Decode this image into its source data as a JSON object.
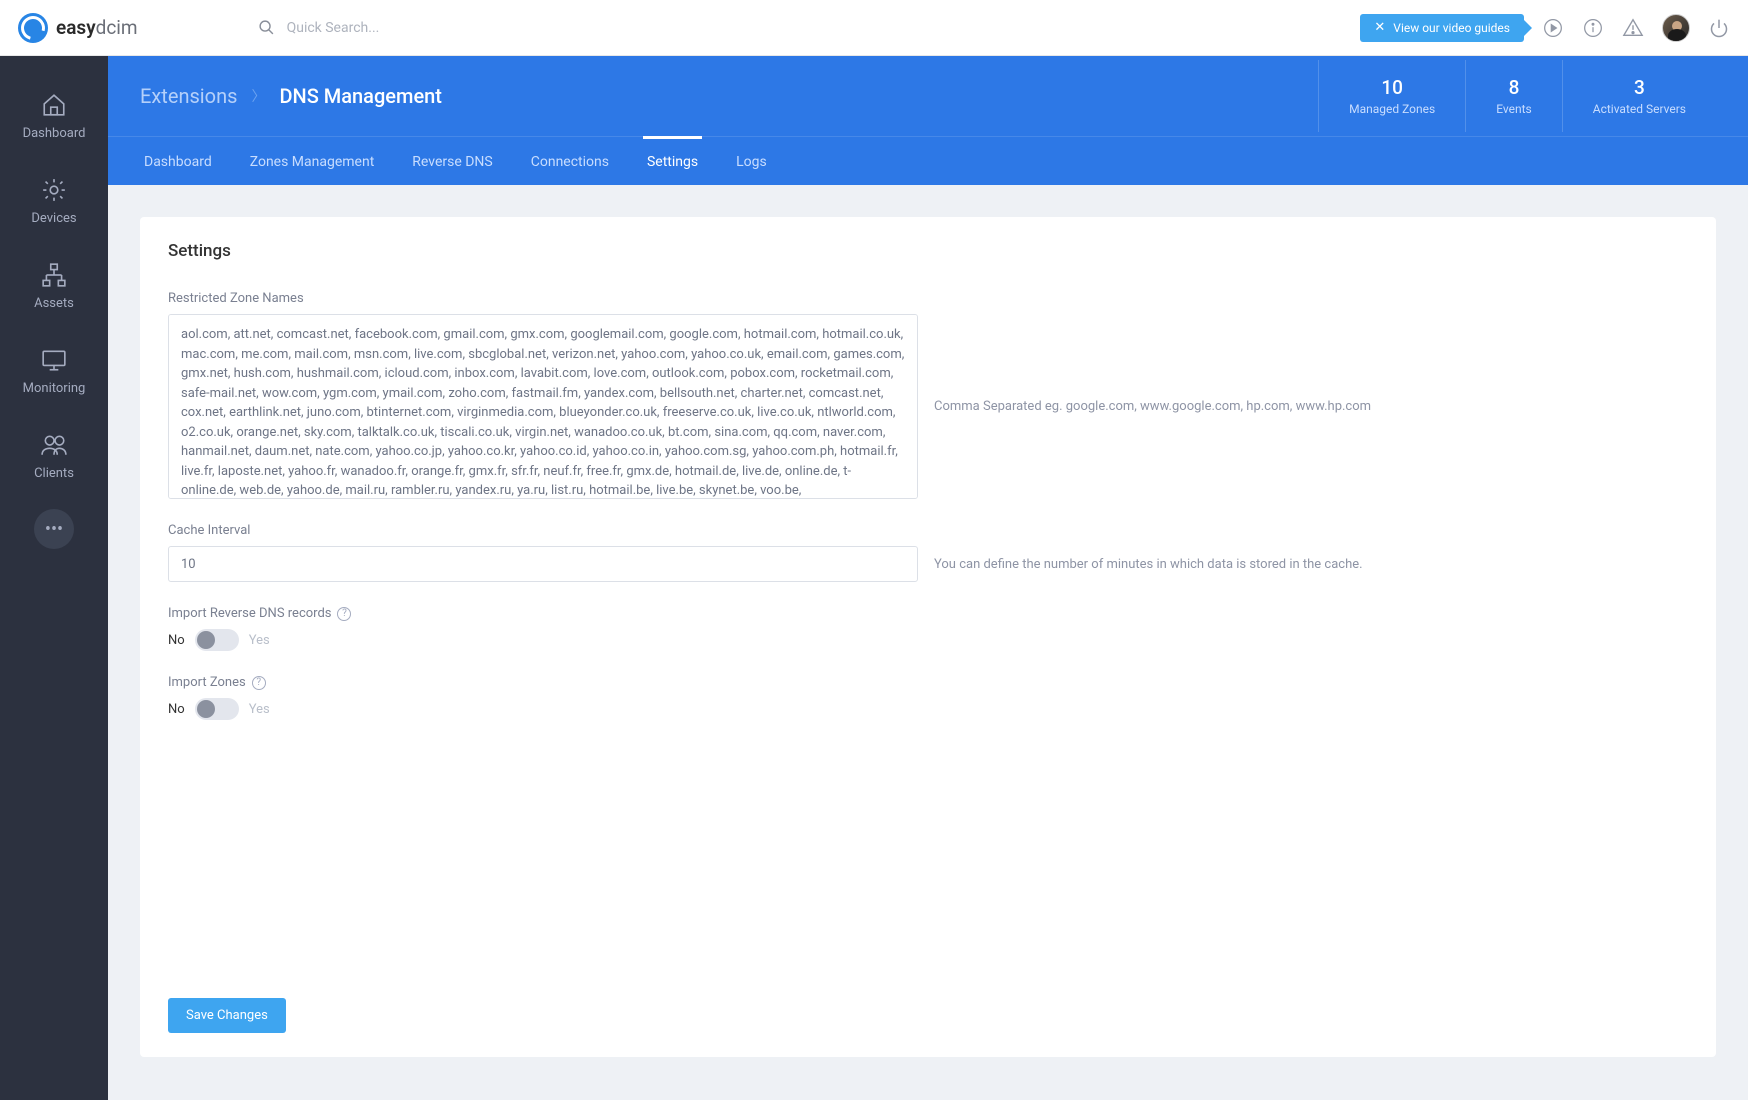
{
  "brand": {
    "name_prefix": "easy",
    "name_suffix": "dcim"
  },
  "topbar": {
    "search_placeholder": "Quick Search...",
    "video_guide_label": "View our video guides"
  },
  "sidebar": {
    "items": [
      {
        "id": "dashboard",
        "label": "Dashboard"
      },
      {
        "id": "devices",
        "label": "Devices"
      },
      {
        "id": "assets",
        "label": "Assets"
      },
      {
        "id": "monitoring",
        "label": "Monitoring"
      },
      {
        "id": "clients",
        "label": "Clients"
      }
    ]
  },
  "breadcrumb": {
    "parent": "Extensions",
    "current": "DNS Management"
  },
  "stats": [
    {
      "value": "10",
      "label": "Managed Zones"
    },
    {
      "value": "8",
      "label": "Events"
    },
    {
      "value": "3",
      "label": "Activated Servers"
    }
  ],
  "tabs": [
    {
      "id": "dashboard",
      "label": "Dashboard"
    },
    {
      "id": "zones",
      "label": "Zones Management"
    },
    {
      "id": "reverse",
      "label": "Reverse DNS"
    },
    {
      "id": "connections",
      "label": "Connections"
    },
    {
      "id": "settings",
      "label": "Settings",
      "active": true
    },
    {
      "id": "logs",
      "label": "Logs"
    }
  ],
  "settings": {
    "page_title": "Settings",
    "restricted": {
      "label": "Restricted Zone Names",
      "value": "aol.com, att.net, comcast.net, facebook.com, gmail.com, gmx.com, googlemail.com, google.com, hotmail.com, hotmail.co.uk, mac.com, me.com, mail.com, msn.com, live.com, sbcglobal.net, verizon.net, yahoo.com, yahoo.co.uk, email.com, games.com, gmx.net, hush.com, hushmail.com, icloud.com, inbox.com, lavabit.com, love.com, outlook.com, pobox.com, rocketmail.com, safe-mail.net, wow.com, ygm.com, ymail.com, zoho.com, fastmail.fm, yandex.com, bellsouth.net, charter.net, comcast.net, cox.net, earthlink.net, juno.com, btinternet.com, virginmedia.com, blueyonder.co.uk, freeserve.co.uk, live.co.uk, ntlworld.com, o2.co.uk, orange.net, sky.com, talktalk.co.uk, tiscali.co.uk, virgin.net, wanadoo.co.uk, bt.com, sina.com, qq.com, naver.com, hanmail.net, daum.net, nate.com, yahoo.co.jp, yahoo.co.kr, yahoo.co.id, yahoo.co.in, yahoo.com.sg, yahoo.com.ph, hotmail.fr, live.fr, laposte.net, yahoo.fr, wanadoo.fr, orange.fr, gmx.fr, sfr.fr, neuf.fr, free.fr, gmx.de, hotmail.de, live.de, online.de, t-online.de, web.de, yahoo.de, mail.ru, rambler.ru, yandex.ru, ya.ru, list.ru, hotmail.be, live.be, skynet.be, voo.be,",
      "hint": "Comma Separated eg. google.com, www.google.com, hp.com, www.hp.com"
    },
    "cache": {
      "label": "Cache Interval",
      "value": "10",
      "hint": "You can define the number of minutes in which data is stored in the cache."
    },
    "import_reverse": {
      "label": "Import Reverse DNS records",
      "no": "No",
      "yes": "Yes"
    },
    "import_zones": {
      "label": "Import Zones",
      "no": "No",
      "yes": "Yes"
    },
    "save_label": "Save Changes"
  }
}
